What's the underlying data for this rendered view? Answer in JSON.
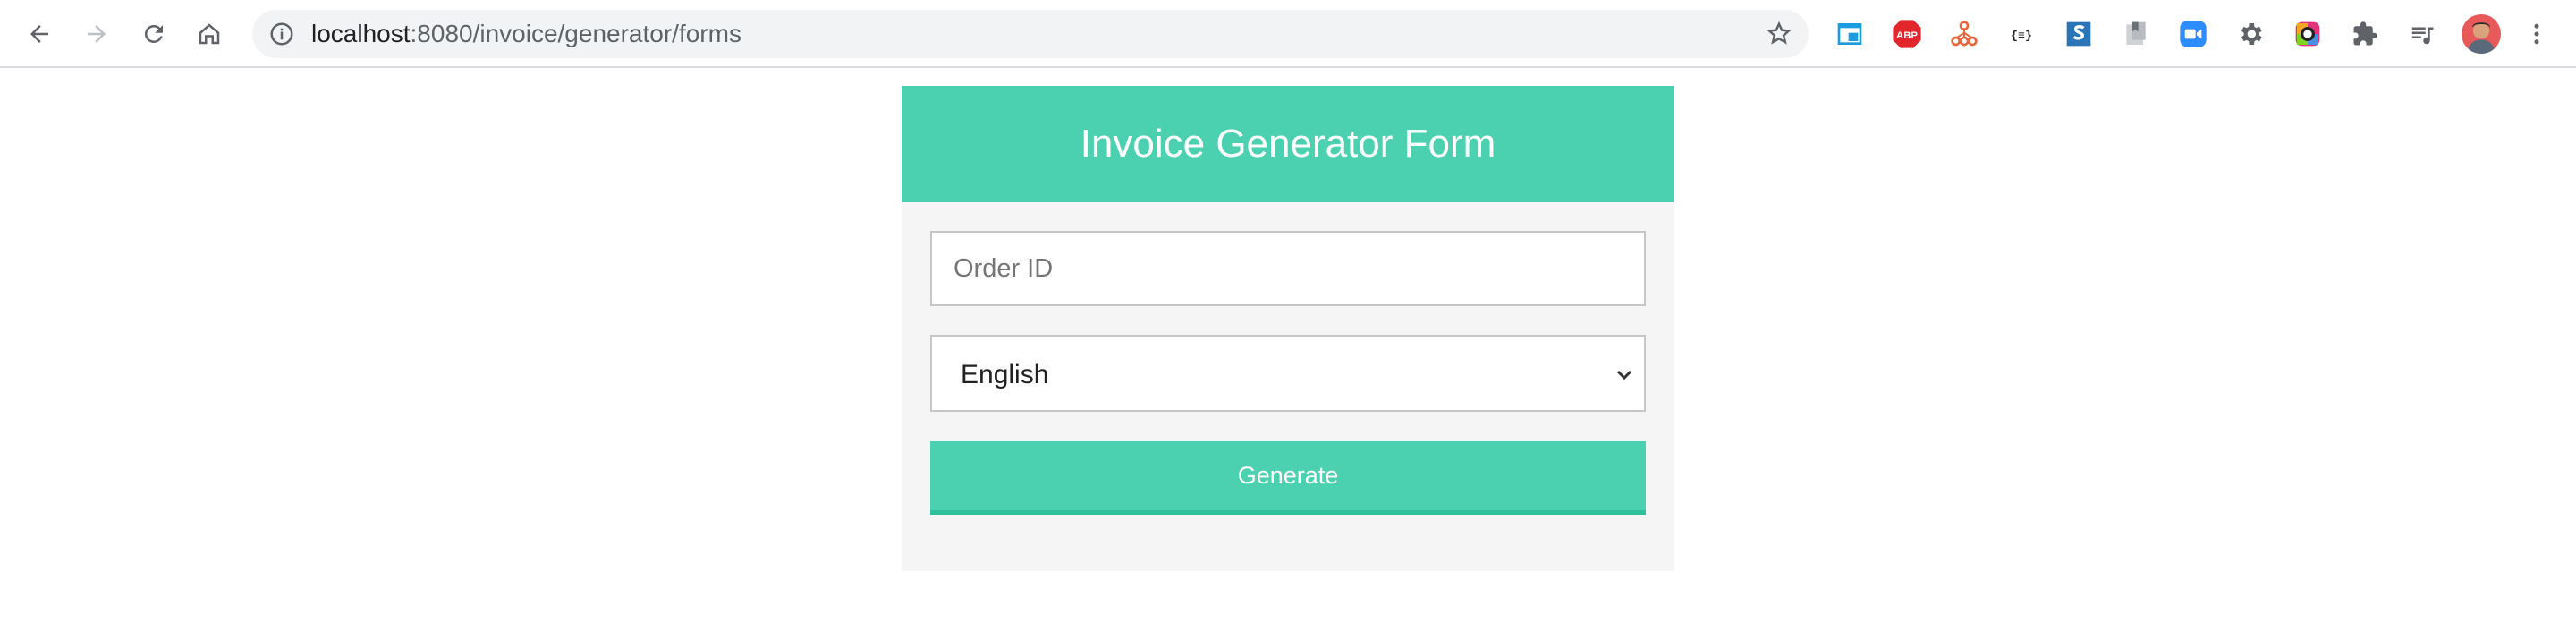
{
  "browser": {
    "url_host": "localhost",
    "url_path": ":8080/invoice/generator/forms",
    "extensions": [
      "window-icon",
      "adblock-icon",
      "network-icon",
      "json-icon",
      "s-icon",
      "bookmark-icon",
      "zoom-icon",
      "gear-icon",
      "color-picker-icon",
      "puzzle-icon",
      "playlist-icon",
      "profile-avatar"
    ],
    "colors": {
      "toolbar_bg": "#ffffff",
      "omnibox_bg": "#f1f3f4"
    }
  },
  "form": {
    "title": "Invoice Generator Form",
    "order_id_placeholder": "Order ID",
    "language_value": "English",
    "generate_label": "Generate",
    "colors": {
      "accent": "#4bd1b0",
      "card_bg": "#f5f5f5"
    }
  }
}
